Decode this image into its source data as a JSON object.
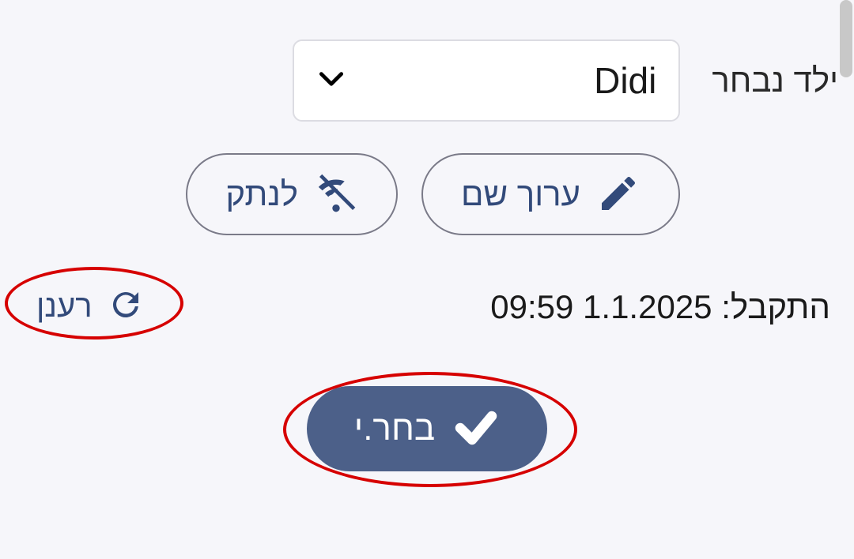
{
  "select_row": {
    "label": "ילד נבחר",
    "value": "Didi"
  },
  "actions": {
    "edit_name": "ערוך שם",
    "disconnect": "לנתק"
  },
  "status": {
    "received_label": "התקבל:",
    "received_datetime": "1.1.2025 09:59",
    "refresh": "רענן"
  },
  "primary": {
    "select": "בחר.י"
  }
}
